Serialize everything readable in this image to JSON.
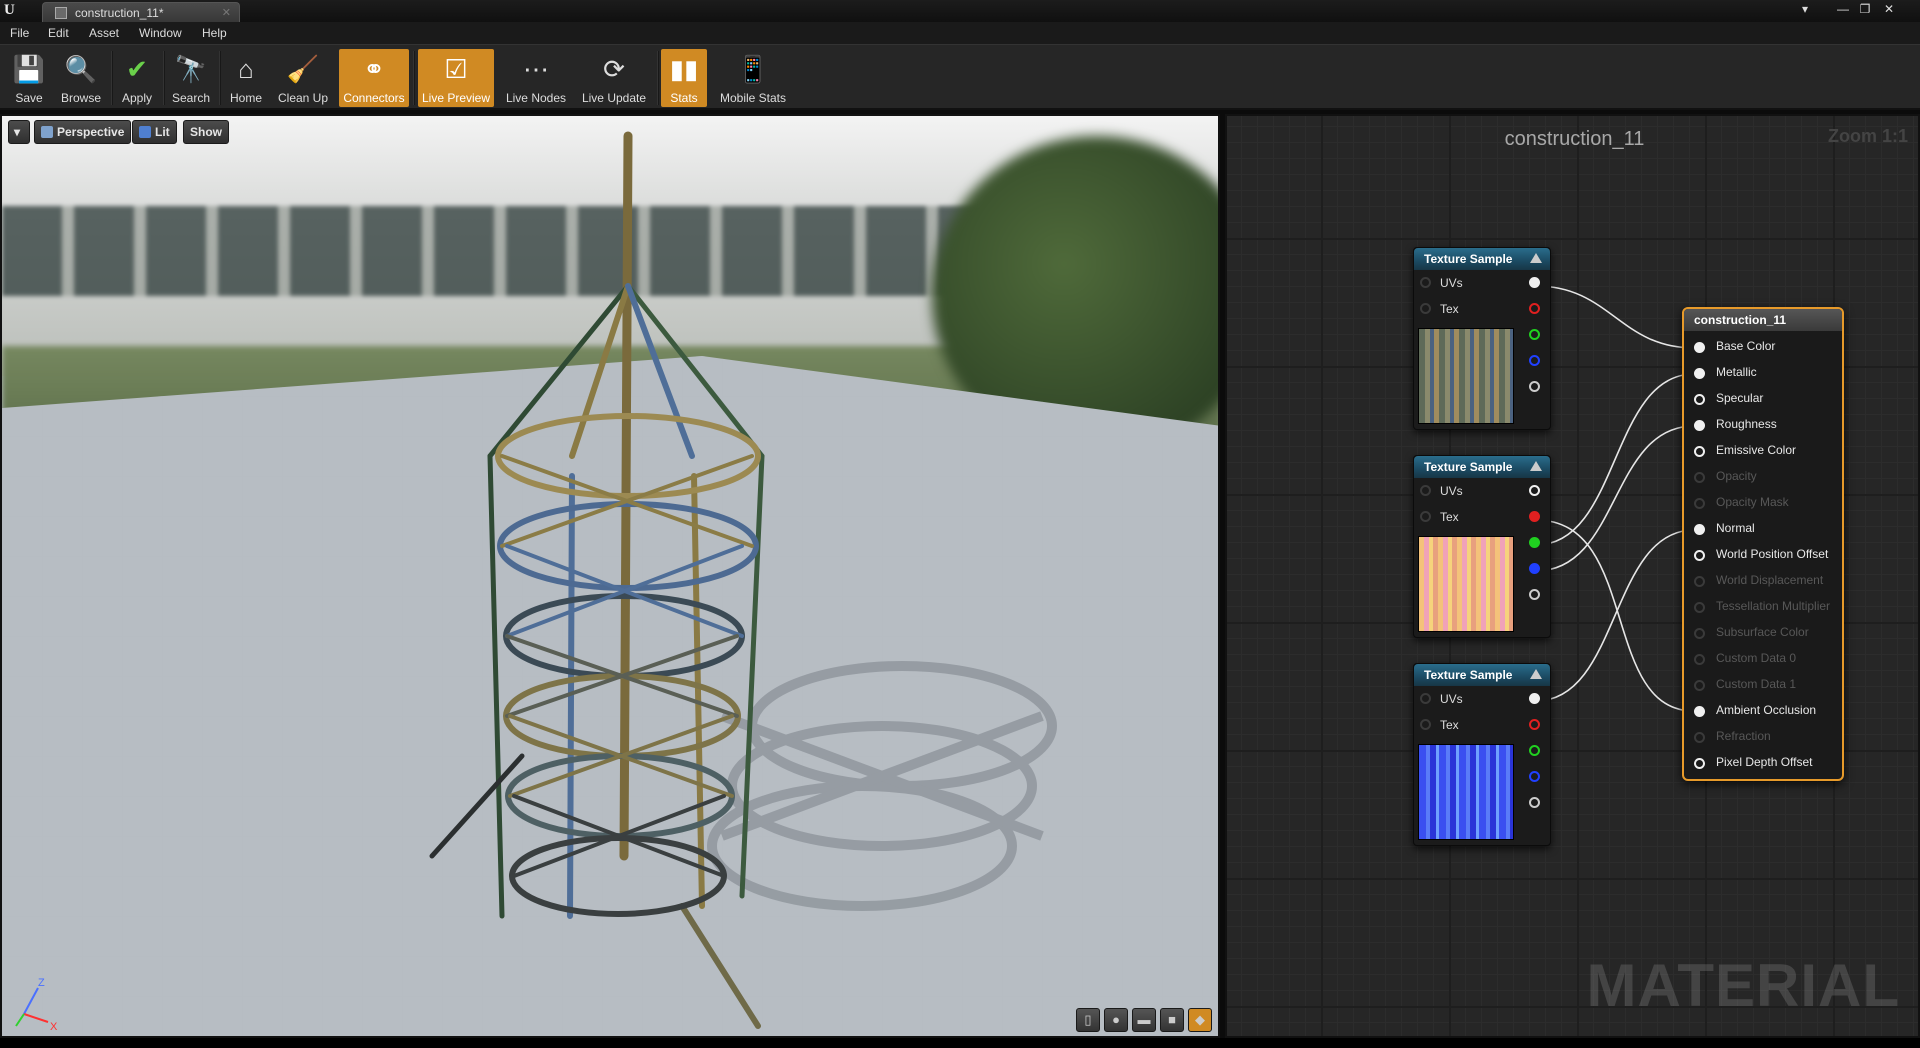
{
  "window": {
    "tab_title": "construction_11*",
    "controls": [
      "▾",
      "—",
      "❐",
      "✕"
    ]
  },
  "menu": [
    "File",
    "Edit",
    "Asset",
    "Window",
    "Help"
  ],
  "toolbar": [
    {
      "label": "Save",
      "icon": "save-icon",
      "active": false
    },
    {
      "label": "Browse",
      "icon": "browse-icon",
      "active": false
    },
    {
      "label": "Apply",
      "icon": "apply-icon",
      "active": false
    },
    {
      "label": "Search",
      "icon": "search-icon",
      "active": false
    },
    {
      "label": "Home",
      "icon": "home-icon",
      "active": false
    },
    {
      "label": "Clean Up",
      "icon": "clean-up-icon",
      "active": false
    },
    {
      "label": "Connectors",
      "icon": "connectors-icon",
      "active": true
    },
    {
      "label": "Live Preview",
      "icon": "live-preview-icon",
      "active": true
    },
    {
      "label": "Live Nodes",
      "icon": "live-nodes-icon",
      "active": false
    },
    {
      "label": "Live Update",
      "icon": "live-update-icon",
      "active": false
    },
    {
      "label": "Stats",
      "icon": "stats-icon",
      "active": true
    },
    {
      "label": "Mobile Stats",
      "icon": "mobile-stats-icon",
      "active": false
    }
  ],
  "viewport": {
    "perspective": "Perspective",
    "lit": "Lit",
    "show": "Show",
    "axis_z": "Z",
    "axis_x": "X"
  },
  "graph": {
    "title": "construction_11",
    "zoom": "Zoom 1:1",
    "watermark": "MATERIAL",
    "texture_nodes": [
      {
        "title": "Texture Sample",
        "inputs": [
          "UVs",
          "Tex"
        ]
      },
      {
        "title": "Texture Sample",
        "inputs": [
          "UVs",
          "Tex"
        ]
      },
      {
        "title": "Texture Sample",
        "inputs": [
          "UVs",
          "Tex"
        ]
      }
    ],
    "material_node": {
      "title": "construction_11",
      "inputs": [
        {
          "label": "Base Color",
          "enabled": true
        },
        {
          "label": "Metallic",
          "enabled": true
        },
        {
          "label": "Specular",
          "enabled": true
        },
        {
          "label": "Roughness",
          "enabled": true
        },
        {
          "label": "Emissive Color",
          "enabled": true
        },
        {
          "label": "Opacity",
          "enabled": false
        },
        {
          "label": "Opacity Mask",
          "enabled": false
        },
        {
          "label": "Normal",
          "enabled": true
        },
        {
          "label": "World Position Offset",
          "enabled": true
        },
        {
          "label": "World Displacement",
          "enabled": false
        },
        {
          "label": "Tessellation Multiplier",
          "enabled": false
        },
        {
          "label": "Subsurface Color",
          "enabled": false
        },
        {
          "label": "Custom Data 0",
          "enabled": false
        },
        {
          "label": "Custom Data 1",
          "enabled": false
        },
        {
          "label": "Ambient Occlusion",
          "enabled": true
        },
        {
          "label": "Refraction",
          "enabled": false
        },
        {
          "label": "Pixel Depth Offset",
          "enabled": true
        }
      ]
    }
  },
  "colors": {
    "accent": "#d08a23",
    "node_header": "#2a6d8c",
    "material_border": "#e79a2a",
    "pin_red": "#e02020",
    "pin_green": "#20d020",
    "pin_blue": "#2040ff"
  }
}
